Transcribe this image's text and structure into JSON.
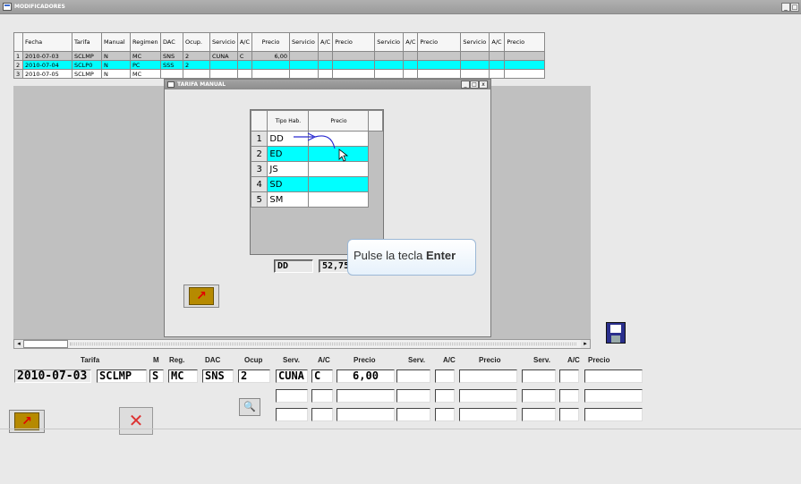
{
  "window": {
    "title": "MODIFICADORES",
    "controls": [
      "_",
      "□"
    ]
  },
  "grid": {
    "headers": [
      "",
      "Fecha",
      "Tarifa",
      "Manual",
      "Regimen",
      "DAC",
      "Ocup.",
      "Servicio",
      "A/C",
      "Precio",
      "Servicio",
      "A/C",
      "Precio",
      "Servicio",
      "A/C",
      "Precio",
      "Servicio",
      "A/C",
      "Precio"
    ],
    "rows": [
      [
        "1",
        "2010-07-03",
        "SCLMP",
        "N",
        "MC",
        "SNS",
        "2",
        "CUNA",
        "C",
        "6,00",
        "",
        "",
        "",
        "",
        "",
        "",
        "",
        "",
        ""
      ],
      [
        "2",
        "2010-07-04",
        "SCLP0",
        "N",
        "PC",
        "SSS",
        "2",
        "",
        "",
        "",
        "",
        "",
        "",
        "",
        "",
        "",
        "",
        "",
        ""
      ],
      [
        "3",
        "2010-07-05",
        "SCLMP",
        "N",
        "MC",
        "",
        "",
        "",
        "",
        "",
        "",
        "",
        "",
        "",
        "",
        "",
        "",
        "",
        ""
      ]
    ]
  },
  "dialog": {
    "title": "TARIFA MANUAL",
    "controls": [
      "_",
      "□",
      "x"
    ],
    "headers": [
      "",
      "Tipo Hab.",
      "Precio",
      ""
    ],
    "rows": [
      {
        "num": "1",
        "tipo": "DD",
        "precio": ""
      },
      {
        "num": "2",
        "tipo": "ED",
        "precio": ""
      },
      {
        "num": "3",
        "tipo": "JS",
        "precio": ""
      },
      {
        "num": "4",
        "tipo": "SD",
        "precio": ""
      },
      {
        "num": "5",
        "tipo": "SM",
        "precio": ""
      }
    ],
    "field_tipo": "DD",
    "field_precio": "52,75",
    "exit_icon": "exit-door-icon"
  },
  "tooltip": {
    "prefix": "Pulse la tecla",
    "key": "Enter"
  },
  "form": {
    "labels": {
      "tarifa": "Tarifa",
      "m": "M",
      "reg": "Reg.",
      "dac": "DAC",
      "ocup": "Ocup",
      "serv1": "Serv.",
      "ac1": "A/C",
      "precio1": "Precio",
      "serv2": "Serv.",
      "ac2": "A/C",
      "precio2": "Precio",
      "serv3": "Serv.",
      "ac3": "A/C",
      "precio3": "Precio"
    },
    "fecha": "2010-07-03",
    "tarifa": "SCLMP",
    "m": "S",
    "reg": "MC",
    "dac": "SNS",
    "ocup": "2",
    "serv1": "CUNA",
    "ac1": "C",
    "precio1": "6,00"
  },
  "icons": {
    "save": "save-disk-icon",
    "search": "magnifier-icon",
    "exit": "exit-door-icon",
    "cancel": "cancel-icon"
  },
  "colors": {
    "highlight": "#00ffff",
    "selected_row": "#c7c7c7"
  }
}
